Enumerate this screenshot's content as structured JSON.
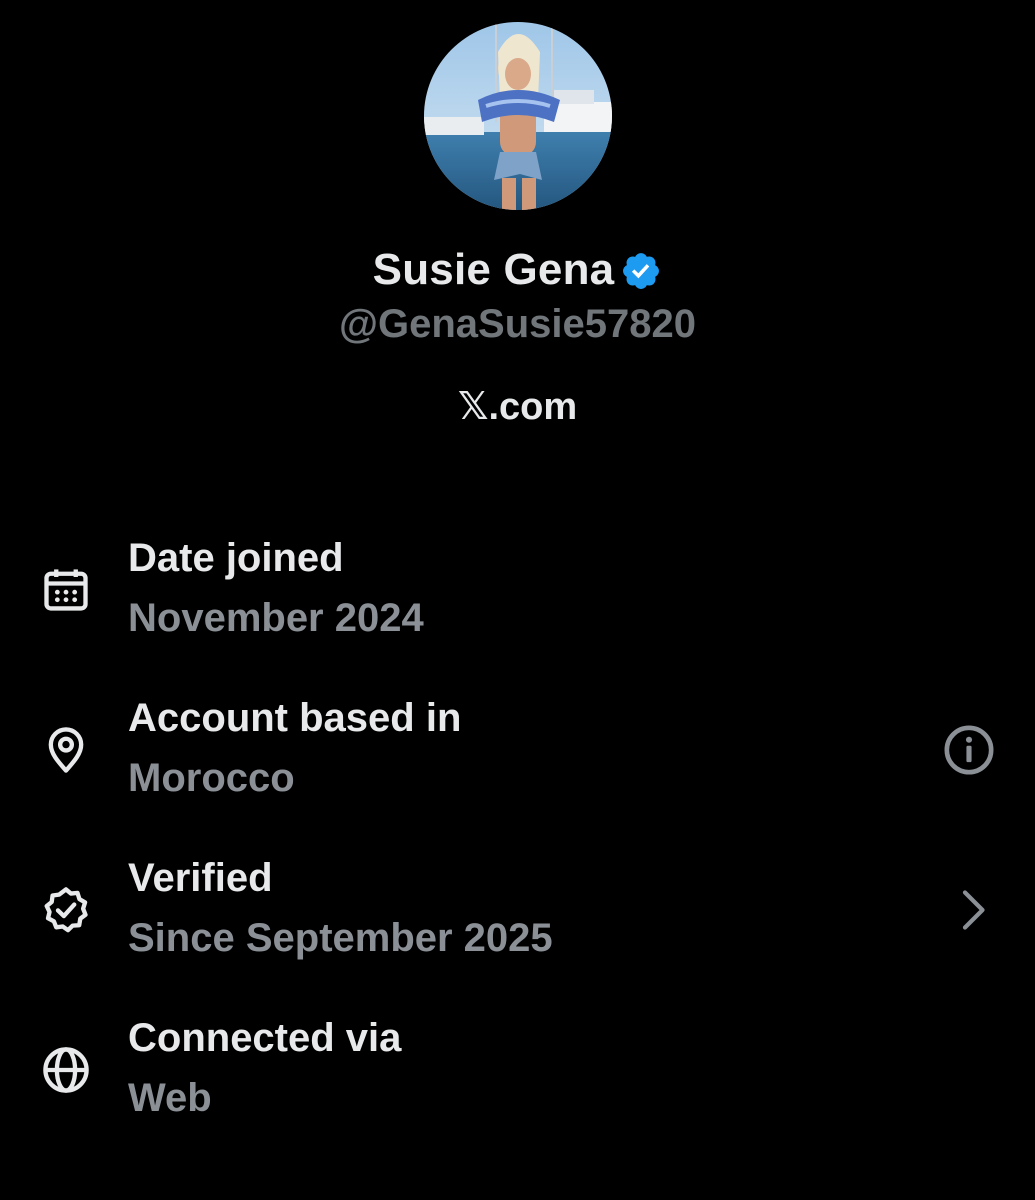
{
  "profile": {
    "display_name": "Susie Gena",
    "handle": "@GenaSusie57820",
    "source_site": "𝕏.com",
    "verified_badge_color": "#1d9bf0"
  },
  "details": [
    {
      "icon": "calendar-icon",
      "title": "Date joined",
      "value": "November 2024"
    },
    {
      "icon": "location-pin-icon",
      "title": "Account based in",
      "value": "Morocco",
      "action_icon": "info-icon"
    },
    {
      "icon": "verified-check-icon",
      "title": "Verified",
      "value": "Since September 2025",
      "action_icon": "chevron-right-icon"
    },
    {
      "icon": "globe-icon",
      "title": "Connected via",
      "value": "Web"
    }
  ],
  "colors": {
    "background": "#000000",
    "primary_text": "#e7e9ea",
    "secondary_text": "#71767b",
    "accent": "#1d9bf0"
  }
}
